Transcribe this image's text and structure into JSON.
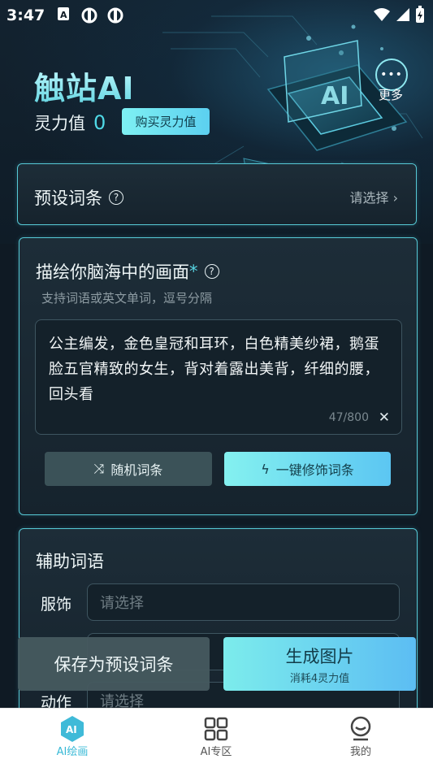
{
  "status_bar": {
    "time": "3:47"
  },
  "header": {
    "brand": "触站AI",
    "power_label": "灵力值",
    "power_value": "0",
    "buy_button": "购买灵力值",
    "more_label": "更多",
    "more_icon": "•••"
  },
  "preset": {
    "title": "预设词条",
    "help_icon": "?",
    "select_text": "请选择 ›"
  },
  "describe": {
    "title": "描绘你脑海中的画面",
    "required_mark": "*",
    "help_icon": "?",
    "hint": "支持词语或英文单词，逗号分隔",
    "prompt_text": "公主编发，金色皇冠和耳环，白色精美纱裙，鹅蛋脸五官精致的女生，背对着露出美背，纤细的腰，回头看",
    "char_count": "47/800",
    "clear_icon": "✕",
    "random_button": "随机词条",
    "random_icon": "⤨",
    "decorate_button": "一键修饰词条",
    "decorate_icon": "ϟ"
  },
  "assist": {
    "title": "辅助词语",
    "rows": [
      {
        "label": "服饰",
        "placeholder": "请选择"
      },
      {
        "label": "动作",
        "placeholder": "请选择"
      }
    ]
  },
  "actions": {
    "save_button": "保存为预设词条",
    "generate_button": "生成图片",
    "generate_cost": "消耗4灵力值"
  },
  "tabbar": {
    "items": [
      {
        "label": "AI绘画",
        "icon": "ai-hexagon-icon",
        "active": true
      },
      {
        "label": "AI专区",
        "icon": "grid-icon",
        "active": false
      },
      {
        "label": "我的",
        "icon": "profile-icon",
        "active": false
      }
    ]
  },
  "colors": {
    "accent": "#56c9d6",
    "tab_active": "#38b9d6",
    "background": "#0f1a24"
  }
}
